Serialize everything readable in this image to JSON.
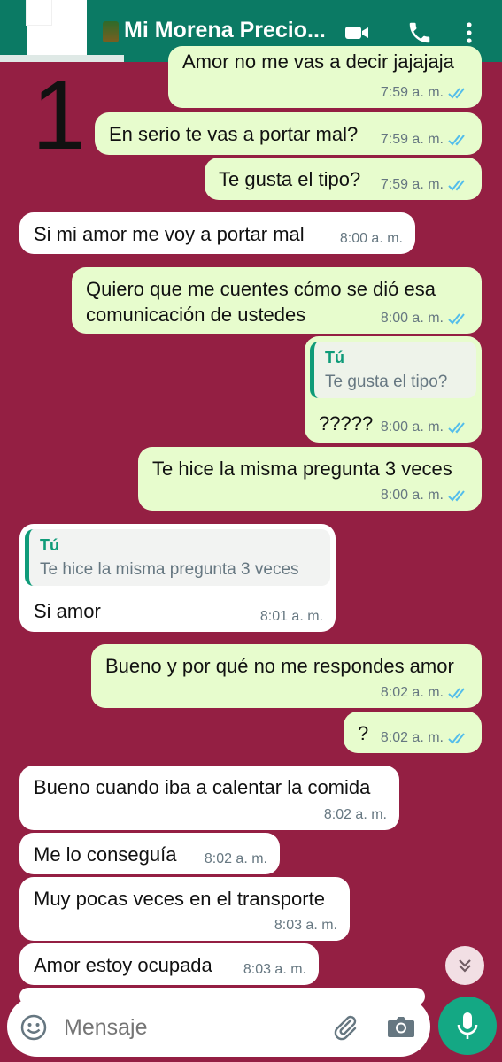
{
  "header": {
    "contact_name": "Mi Morena Precio...",
    "icons": [
      "video-call-icon",
      "voice-call-icon",
      "more-options-icon"
    ]
  },
  "overlay_counter": "1",
  "messages": [
    {
      "dir": "out",
      "text": "Amor no me vas a decir jajajaja",
      "time": "7:59 a. m.",
      "ticks": "read"
    },
    {
      "dir": "out",
      "text": "En serio te vas a portar mal?",
      "time": "7:59 a. m.",
      "ticks": "read"
    },
    {
      "dir": "out",
      "text": "Te gusta el tipo?",
      "time": "7:59 a. m.",
      "ticks": "read"
    },
    {
      "dir": "in",
      "text": "Si mi amor me voy a portar mal",
      "time": "8:00 a. m."
    },
    {
      "dir": "out",
      "text": "Quiero que me cuentes cómo se dió esa\ncomunicación de ustedes",
      "time": "8:00 a. m.",
      "ticks": "read"
    },
    {
      "dir": "out",
      "quote": {
        "author": "Tú",
        "text": "Te gusta el tipo?"
      },
      "text": "?????",
      "time": "8:00 a. m.",
      "ticks": "read"
    },
    {
      "dir": "out",
      "text": "Te hice la misma pregunta 3 veces",
      "time": "8:00 a. m.",
      "ticks": "read"
    },
    {
      "dir": "in",
      "quote": {
        "author": "Tú",
        "text": "Te hice la misma pregunta 3 veces"
      },
      "text": "Si amor",
      "time": "8:01 a. m."
    },
    {
      "dir": "out",
      "text": "Bueno y por qué no me respondes amor",
      "time": "8:02 a. m.",
      "ticks": "read"
    },
    {
      "dir": "out",
      "text": "?",
      "time": "8:02 a. m.",
      "ticks": "read"
    },
    {
      "dir": "in",
      "text": "Bueno cuando iba a calentar la comida",
      "time": "8:02 a. m."
    },
    {
      "dir": "in",
      "text": "Me lo conseguía",
      "time": "8:02 a. m."
    },
    {
      "dir": "in",
      "text": "Muy pocas veces en el transporte",
      "time": "8:03 a. m."
    },
    {
      "dir": "in",
      "text": "Amor estoy ocupada",
      "time": "8:03 a. m."
    }
  ],
  "composer": {
    "placeholder": "Mensaje",
    "icons": [
      "emoji-icon",
      "attach-icon",
      "camera-icon",
      "microphone-icon"
    ]
  },
  "colors": {
    "header": "#0b7a64",
    "wallpaper": "#941f43",
    "outgoing_bubble": "#e7fccd",
    "incoming_bubble": "#ffffff",
    "read_ticks": "#53bdeb",
    "quote_author": "#0f9b79",
    "mic_button": "#14a884"
  }
}
